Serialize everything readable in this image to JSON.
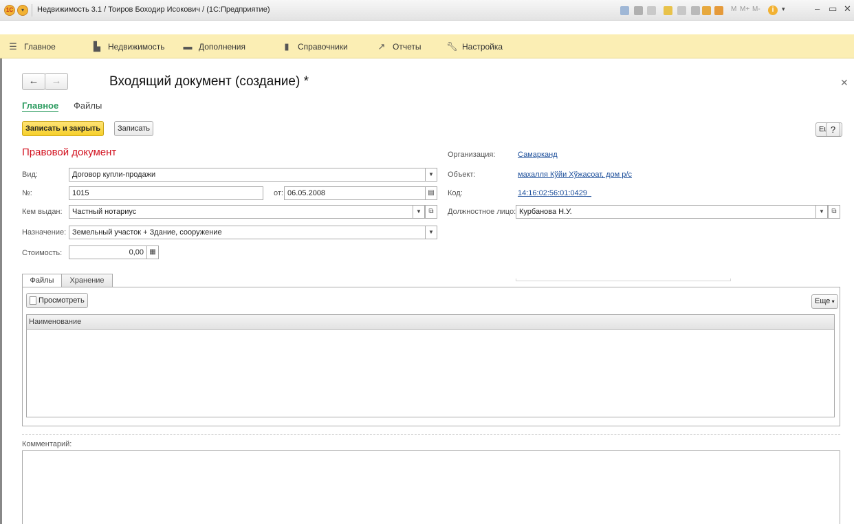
{
  "window": {
    "title": "Недвижимость 3.1 / Тоиров Боходир Исокович / (1С:Предприятие)",
    "logo_text": "1С",
    "toolbar_labels": [
      "M",
      "M+",
      "M-"
    ]
  },
  "sections": [
    {
      "label": "Главное",
      "icon": "menu-icon"
    },
    {
      "label": "Недвижимость",
      "icon": "building-icon"
    },
    {
      "label": "Дополнения",
      "icon": "folder-icon"
    },
    {
      "label": "Справочники",
      "icon": "book-icon"
    },
    {
      "label": "Отчеты",
      "icon": "chart-icon"
    },
    {
      "label": "Настройка",
      "icon": "wrench-icon"
    }
  ],
  "form": {
    "title": "Входящий документ (создание) *",
    "tabs": [
      "Главное",
      "Файлы"
    ],
    "buttons": {
      "save_close": "Записать и закрыть",
      "save": "Записать",
      "more": "Еще",
      "help": "?"
    },
    "section_title": "Правовой документ",
    "fields": {
      "kind_label": "Вид:",
      "kind_value": "Договор купли-продажи",
      "number_label": "№:",
      "number_value": "1015",
      "date_label": "от:",
      "date_value": "06.05.2008",
      "issuer_label": "Кем выдан:",
      "issuer_value": "Частный нотариус",
      "purpose_label": "Назначение:",
      "purpose_value": "Земельный участок + Здание, сооружение",
      "cost_label": "Стоимость:",
      "cost_value": "0,00"
    },
    "right": {
      "org_label": "Организация:",
      "org_value": "Самарканд",
      "object_label": "Объект:",
      "object_value": "махалля Кўйи Хўжасоат, дом р/с",
      "code_label": "Код:",
      "code_value": "14:16:02:56:01:0429_",
      "official_label": "Должностное лицо:",
      "official_value": "Курбанова Н.У."
    },
    "inner_tabs": [
      "Файлы",
      "Хранение"
    ],
    "files": {
      "view_button": "Просмотреть",
      "more": "Еще",
      "column": "Наименование"
    },
    "comment_label": "Комментарий:"
  },
  "colors": {
    "section_bar": "#fbeeb4",
    "primary_button": "#f6cf2a",
    "section_title": "#d2101e",
    "active_tab": "#2b9b5f",
    "link": "#1d4f9b"
  }
}
